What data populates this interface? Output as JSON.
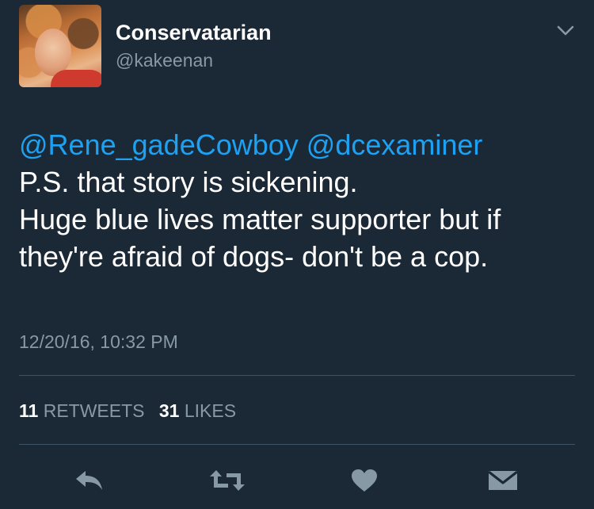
{
  "user": {
    "display_name": "Conservatarian",
    "handle": "@kakeenan"
  },
  "tweet": {
    "mentions": "@Rene_gadeCowboy @dcexaminer",
    "lines": [
      "P.S. that story is sickening.",
      "Huge blue lives matter supporter but if",
      "they're afraid of dogs- don't be a cop."
    ],
    "timestamp": "12/20/16, 10:32 PM"
  },
  "stats": {
    "retweets_count": "11",
    "retweets_label": "RETWEETS",
    "likes_count": "31",
    "likes_label": "LIKES"
  },
  "icons": {
    "menu": "chevron-down-icon",
    "reply": "reply-icon",
    "retweet": "retweet-icon",
    "like": "heart-icon",
    "message": "envelope-icon"
  },
  "colors": {
    "background": "#1b2836",
    "mention": "#1da1f2",
    "secondary_text": "#8899a6",
    "icon": "#8899a6"
  }
}
